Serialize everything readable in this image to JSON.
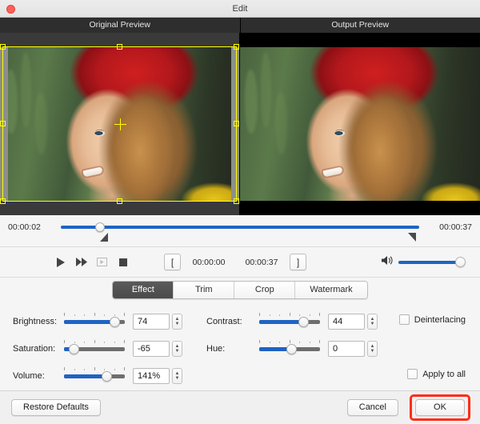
{
  "window": {
    "title": "Edit",
    "close_button": "close-red"
  },
  "previews": {
    "original_label": "Original Preview",
    "output_label": "Output Preview"
  },
  "timeline": {
    "start_time": "00:00:02",
    "end_time": "00:00:37",
    "playhead_percent": 11
  },
  "transport": {
    "play": "play-icon",
    "fast_forward": "fast-forward-icon",
    "frame_step": "frame-step-icon",
    "stop": "stop-icon",
    "mark_in_label": "[",
    "mark_out_label": "]",
    "in_time": "00:00:00",
    "out_time": "00:00:37",
    "volume_icon": "speaker-icon",
    "volume_percent": 100
  },
  "tabs": [
    {
      "label": "Effect",
      "active": true
    },
    {
      "label": "Trim",
      "active": false
    },
    {
      "label": "Crop",
      "active": false
    },
    {
      "label": "Watermark",
      "active": false
    }
  ],
  "controls": {
    "brightness": {
      "label": "Brightness:",
      "value": "74",
      "fill_percent": 83
    },
    "contrast": {
      "label": "Contrast:",
      "value": "44",
      "fill_percent": 72
    },
    "saturation": {
      "label": "Saturation:",
      "value": "-65",
      "fill_percent": 16
    },
    "hue": {
      "label": "Hue:",
      "value": "0",
      "fill_percent": 52
    },
    "volume": {
      "label": "Volume:",
      "value": "141%",
      "fill_percent": 70
    },
    "deinterlacing": {
      "label": "Deinterlacing",
      "checked": false
    },
    "apply_to_all": {
      "label": "Apply to all",
      "checked": false
    }
  },
  "footer": {
    "restore_defaults": "Restore Defaults",
    "cancel": "Cancel",
    "ok": "OK",
    "ok_highlight_color": "#ff2d16"
  }
}
